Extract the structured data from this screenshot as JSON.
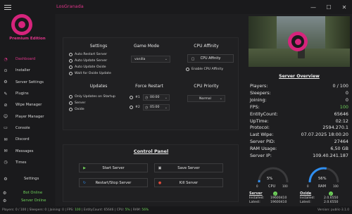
{
  "window": {
    "title": "LosGranada",
    "minimize": "—",
    "maximize": "☐",
    "close": "✕"
  },
  "sidebar": {
    "edition": "Premium Edition",
    "items": [
      {
        "label": "Dashboard",
        "icon": "dashboard-icon",
        "glyph": "◔",
        "active": true
      },
      {
        "label": "Installer",
        "icon": "installer-icon",
        "glyph": "⊙"
      },
      {
        "label": "Server Settings",
        "icon": "settings-icon",
        "glyph": "⚙"
      },
      {
        "label": "Plugins",
        "icon": "plugins-icon",
        "glyph": "✎"
      },
      {
        "label": "Wipe Manager",
        "icon": "wipe-icon",
        "glyph": "⊘"
      },
      {
        "label": "Player Manager",
        "icon": "player-icon",
        "glyph": "☺"
      },
      {
        "label": "Console",
        "icon": "console-icon",
        "glyph": "▭"
      },
      {
        "label": "Discord",
        "icon": "discord-icon",
        "glyph": "✉"
      },
      {
        "label": "Messages",
        "icon": "messages-icon",
        "glyph": "✉"
      },
      {
        "label": "Times",
        "icon": "clock-icon",
        "glyph": "◷"
      }
    ],
    "settings": {
      "label": "Settings",
      "glyph": "⚙"
    },
    "bot_online": "Bot Online",
    "server_online": "Server Online"
  },
  "settings_panel": {
    "settings_title": "Settings",
    "gamemode_title": "Game Mode",
    "cpu_affinity_title": "CPU Affinity",
    "options": [
      "Auto Restart Server",
      "Auto Update Server",
      "Auto Update Oxide",
      "Wait for Oxide Update"
    ],
    "gamemode_value": "vanilla",
    "cpu_affinity_button": "CPU Affinity",
    "enable_cpu_affinity": "Enable CPU Affinity"
  },
  "updates_panel": {
    "updates_title": "Updates",
    "force_restart_title": "Force Restart",
    "cpu_priority_title": "CPU Priority",
    "options": [
      "Only Updates on Startup",
      "Server",
      "Oxide"
    ],
    "restart1_label": "#1",
    "restart1_time": "00:00",
    "restart2_label": "#2",
    "restart2_time": "05:00",
    "cpu_priority_value": "Normal"
  },
  "control_panel": {
    "title": "Control Panel",
    "start": "Start Server",
    "save": "Save Server",
    "restart_stop": "Restart/Stop Server",
    "kill": "Kill Server"
  },
  "overview": {
    "title": "Server Overview",
    "stats": [
      {
        "k": "Players:",
        "v": "0 / 100"
      },
      {
        "k": "Sleepers:",
        "v": "0"
      },
      {
        "k": "Joining:",
        "v": "0"
      },
      {
        "k": "FPS:",
        "v": "100",
        "green": true
      },
      {
        "k": "EntityCount:",
        "v": "65646"
      },
      {
        "k": "UpTime:",
        "v": "02:12"
      },
      {
        "k": "Protocol:",
        "v": "2594.270.1"
      },
      {
        "k": "Last Wipe:",
        "v": "07.07.2025 18:00:20"
      },
      {
        "k": "Server PID:",
        "v": "27464"
      },
      {
        "k": "RAM Usage:",
        "v": "6,50 GB"
      },
      {
        "k": "Server IP:",
        "v": "109.40.241.187"
      }
    ],
    "cpu_pct": "5%",
    "cpu_fraction": 0.05,
    "cpu_label": "CPU",
    "ram_pct": "56%",
    "ram_fraction": 0.56,
    "ram_label": "RAM",
    "gauge_min": "0",
    "gauge_max": "100",
    "server_hdr": "Server",
    "oxide_hdr": "Oxide",
    "installed_label": "Installed:",
    "latest_label": "Latest:",
    "server_installed": "19600410",
    "server_latest": "19600410",
    "oxide_installed": "2.0.6550",
    "oxide_latest": "2.0.6550",
    "accent": "#2f8ef0",
    "ok_color": "#6fd35a"
  },
  "statusbar": {
    "players": "Players: 0 / 100",
    "sleepers": "Sleepers: 0",
    "joining": "Joining: 0",
    "fps_label": "FPS:",
    "fps": "100",
    "entities": "EntityCount: 65646",
    "cpu_label": "CPU:",
    "cpu": "5%",
    "ram_label": "RAM:",
    "ram": "56%",
    "version": "Version: public-3.1.0"
  },
  "colors": {
    "accent_pink": "#e0358a",
    "green": "#6fd35a",
    "blue": "#2f8ef0"
  }
}
